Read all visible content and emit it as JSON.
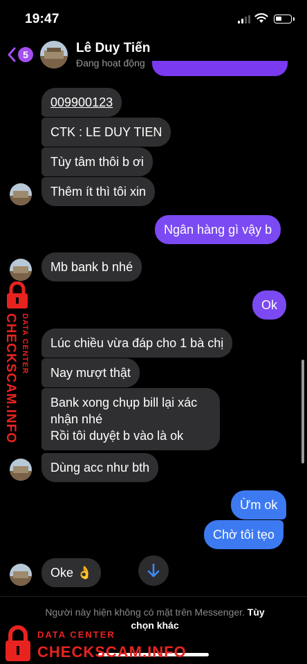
{
  "status_bar": {
    "time": "19:47"
  },
  "header": {
    "back_badge": "5",
    "contact_name": "Lê Duy Tiến",
    "contact_status": "Đang hoạt động"
  },
  "messages": [
    {
      "side": "in",
      "text": "009900123"
    },
    {
      "side": "in",
      "text": "CTK : LE DUY TIEN"
    },
    {
      "side": "in",
      "text": "Tùy tâm thôi b ơi"
    },
    {
      "side": "in",
      "text": "Thêm ít thì tôi xin"
    },
    {
      "side": "out",
      "text": "Ngân hàng gì vậy b"
    },
    {
      "side": "in",
      "text": "Mb bank b nhé"
    },
    {
      "side": "out",
      "text": "Ok"
    },
    {
      "side": "in",
      "text": "Lúc chiều vừa đáp cho 1 bà chị"
    },
    {
      "side": "in",
      "text": "Nay mượt thật"
    },
    {
      "side": "in",
      "lines": [
        "Bank xong chụp bill lại xác",
        "nhận nhé",
        "Rồi tôi duyệt b vào là ok"
      ]
    },
    {
      "side": "in",
      "text": "Dùng acc như bth"
    },
    {
      "side": "out",
      "text": "Ừm ok"
    },
    {
      "side": "out",
      "text": "Chờ tôi tẹo"
    },
    {
      "side": "in",
      "text": "Oke 👌"
    }
  ],
  "footer": {
    "note": "Người này hiện không có mặt trên Messenger.",
    "link_part1": "Tùy",
    "link_part2": "chọn khác"
  },
  "watermark": {
    "small": "DATA CENTER",
    "big": "CHECKSCAM.INFO"
  },
  "colors": {
    "incoming_bubble": "#2f2f31",
    "outgoing_purple": "#7b4af2",
    "outgoing_blue": "#3d7af2",
    "badge": "#a44ff0",
    "watermark": "#e8231f"
  },
  "icons": [
    "back-chevron-icon",
    "signal-icon",
    "wifi-icon",
    "battery-icon",
    "arrow-down-icon",
    "lock-icon",
    "ok-hand-emoji"
  ]
}
